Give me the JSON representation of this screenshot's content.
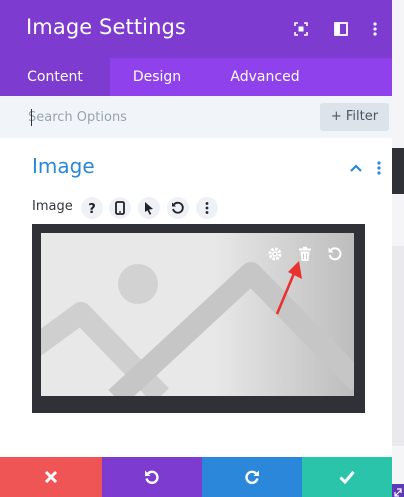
{
  "header": {
    "title": "Image Settings",
    "icons": [
      "fullscreen-icon",
      "sidebar-icon",
      "more-options-icon"
    ]
  },
  "tabs": [
    {
      "label": "Content",
      "active": true
    },
    {
      "label": "Design",
      "active": false
    },
    {
      "label": "Advanced",
      "active": false
    }
  ],
  "search": {
    "placeholder": "Search Options",
    "value": "",
    "filter_label": "+ Filter"
  },
  "section": {
    "title": "Image",
    "expanded": true
  },
  "field": {
    "label": "Image",
    "icons": [
      "help-icon",
      "mobile-icon",
      "cursor-icon",
      "reset-icon",
      "more-icon"
    ]
  },
  "preview": {
    "actions": [
      "settings-gear-icon",
      "delete-trash-icon",
      "reset-icon"
    ]
  },
  "footer": {
    "buttons": [
      "cancel-icon",
      "undo-icon",
      "redo-icon",
      "save-check-icon"
    ]
  },
  "colors": {
    "header": "#7e3bd0",
    "tabs": "#8f42ec",
    "accent": "#2b87da",
    "cancel": "#ef5555",
    "undo": "#7e3bd0",
    "redo": "#2b87da",
    "save": "#29c4a9",
    "annotation_arrow": "#e8322f"
  }
}
